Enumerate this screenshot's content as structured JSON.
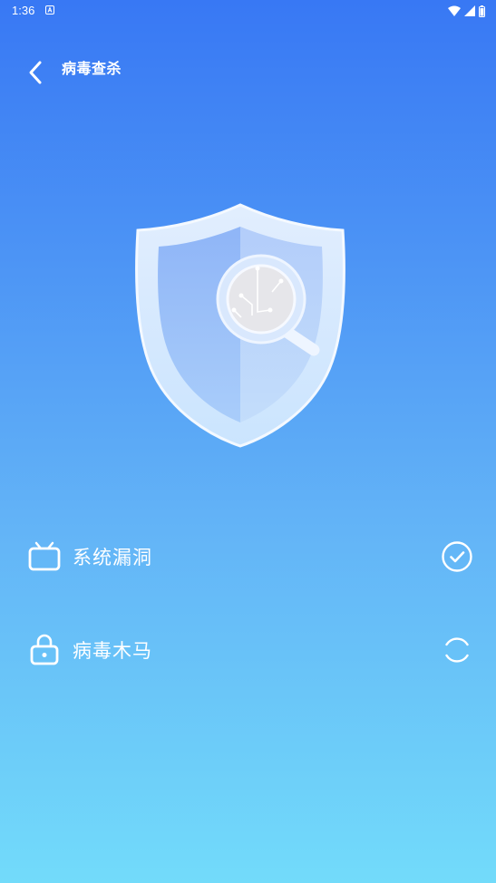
{
  "status_bar": {
    "time": "1:36",
    "icons": [
      "a-icon",
      "wifi-icon",
      "signal-icon",
      "battery-icon"
    ]
  },
  "header": {
    "back_icon": "chevron-left-icon",
    "title": "病毒查杀"
  },
  "illustration": {
    "icon": "shield-magnifier-icon"
  },
  "scan_items": [
    {
      "label": "系统漏洞",
      "icon": "tv-icon",
      "status": "complete",
      "status_icon": "check-circle-icon"
    },
    {
      "label": "病毒木马",
      "icon": "lock-icon",
      "status": "scanning",
      "status_icon": "loading-spinner-icon"
    }
  ],
  "colors": {
    "gradient_top": "#3878f4",
    "gradient_bottom": "#72dbfa",
    "text": "#ffffff"
  }
}
